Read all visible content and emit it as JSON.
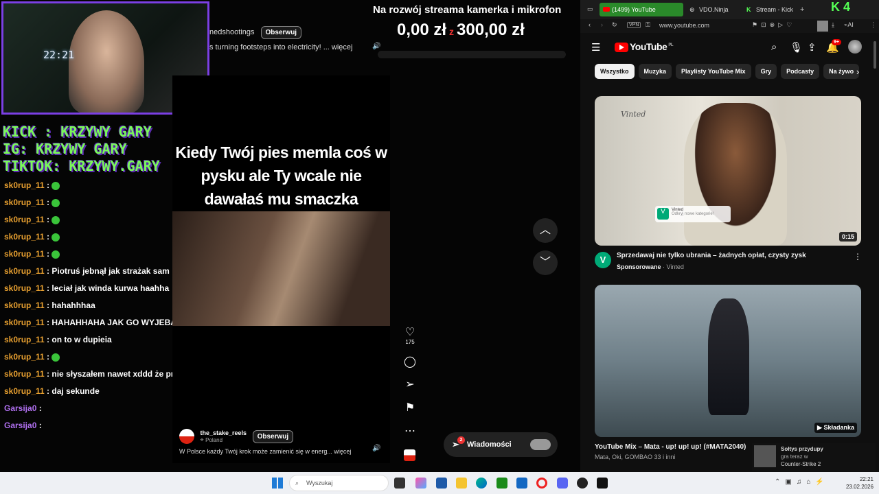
{
  "stream": {
    "title": "Na rozwój streama kamerka i mikrofon",
    "webcam_clock": "22:21",
    "socials": [
      "KICK : KRZYWY GARY",
      "IG: KRZYWY GARY",
      "TIKTOK: KRZYWY.GARY"
    ],
    "donation": {
      "current": "0,00 zł",
      "separator": "z",
      "goal": "300,00 zł",
      "progress_fraction": 0.0
    }
  },
  "top_reel": {
    "author": "nedshootings",
    "follow_label": "Obserwuj",
    "description": "s turning footsteps into electricity! ... więcej"
  },
  "chat": [
    {
      "user": "sk0rup_11",
      "message": "",
      "emote": true
    },
    {
      "user": "sk0rup_11",
      "message": "",
      "emote": true
    },
    {
      "user": "sk0rup_11",
      "message": "",
      "emote": true
    },
    {
      "user": "sk0rup_11",
      "message": "",
      "emote": true
    },
    {
      "user": "sk0rup_11",
      "message": "",
      "emote": true
    },
    {
      "user": "sk0rup_11",
      "message": "Piotruś jebnął jak strażak sam",
      "emote": false
    },
    {
      "user": "sk0rup_11",
      "message": "leciał jak winda kurwa haahha",
      "emote": false
    },
    {
      "user": "sk0rup_11",
      "message": "hahahhhaa",
      "emote": false
    },
    {
      "user": "sk0rup_11",
      "message": "HAHAHHAHA JAK GO WYJEBALO",
      "emote": false
    },
    {
      "user": "sk0rup_11",
      "message": "on to w dupieia",
      "emote": false
    },
    {
      "user": "sk0rup_11",
      "message": "",
      "emote": true
    },
    {
      "user": "sk0rup_11",
      "message": "nie słyszałem nawet xddd że prosiłeś",
      "emote": false
    },
    {
      "user": "sk0rup_11",
      "message": "daj sekunde",
      "emote": false
    },
    {
      "user": "Garsija0",
      "message": "",
      "emote": false
    },
    {
      "user": "Garsija0",
      "message": "",
      "emote": false
    }
  ],
  "reel": {
    "caption_lines": [
      "Kiedy Twój pies memla coś w",
      "pysku ale Ty wcale nie",
      "dawałaś mu smaczka"
    ],
    "author": "the_stake_reels",
    "location": "Poland",
    "follow_label": "Obserwuj",
    "description": "W Polsce każdy Twój krok może zamienić się w energ... więcej",
    "likes": "175"
  },
  "messages": {
    "label": "Wiadomości",
    "badge": "2"
  },
  "browser": {
    "tabs": [
      {
        "label": "(1499) YouTube"
      },
      {
        "label": "VDO.Ninja"
      },
      {
        "label": "Stream - Kick"
      }
    ],
    "url": "www.youtube.com",
    "vpn_label": "VPN",
    "ai_label": "AI",
    "notif_badge": "9+",
    "logo_text": "YouTube",
    "logo_region": "PL",
    "chips": [
      "Wszystko",
      "Muzyka",
      "Playlisty YouTube Mix",
      "Gry",
      "Podcasty",
      "Na żywo"
    ],
    "cards": [
      {
        "title": "Sprzedawaj nie tylko ubrania – żadnych opłat, czysty zysk",
        "sponsor": "Sponsorowane",
        "channel": "Vinted",
        "duration": "0:15",
        "brand": "Vinted",
        "sub": "Odkryj nowe kategorie!"
      },
      {
        "title": "YouTube Mix – Mata - up! up! up! (#MATA2040)",
        "meta": "Mata, Oki, GOMBAO 33 i inni",
        "badge": "Składanka"
      }
    ],
    "notification": {
      "title": "Sołtys przydupy",
      "line1": "gra teraz w",
      "line2": "Counter-Strike 2"
    }
  },
  "taskbar": {
    "search_placeholder": "Wyszukaj",
    "time": "22:21",
    "date": "23.02.2026"
  },
  "colors": {
    "accent_purple": "#7b3fe4",
    "chat_user": "#e8a030",
    "yt_red": "#ff0000",
    "tab_active": "#2a8a2a"
  }
}
